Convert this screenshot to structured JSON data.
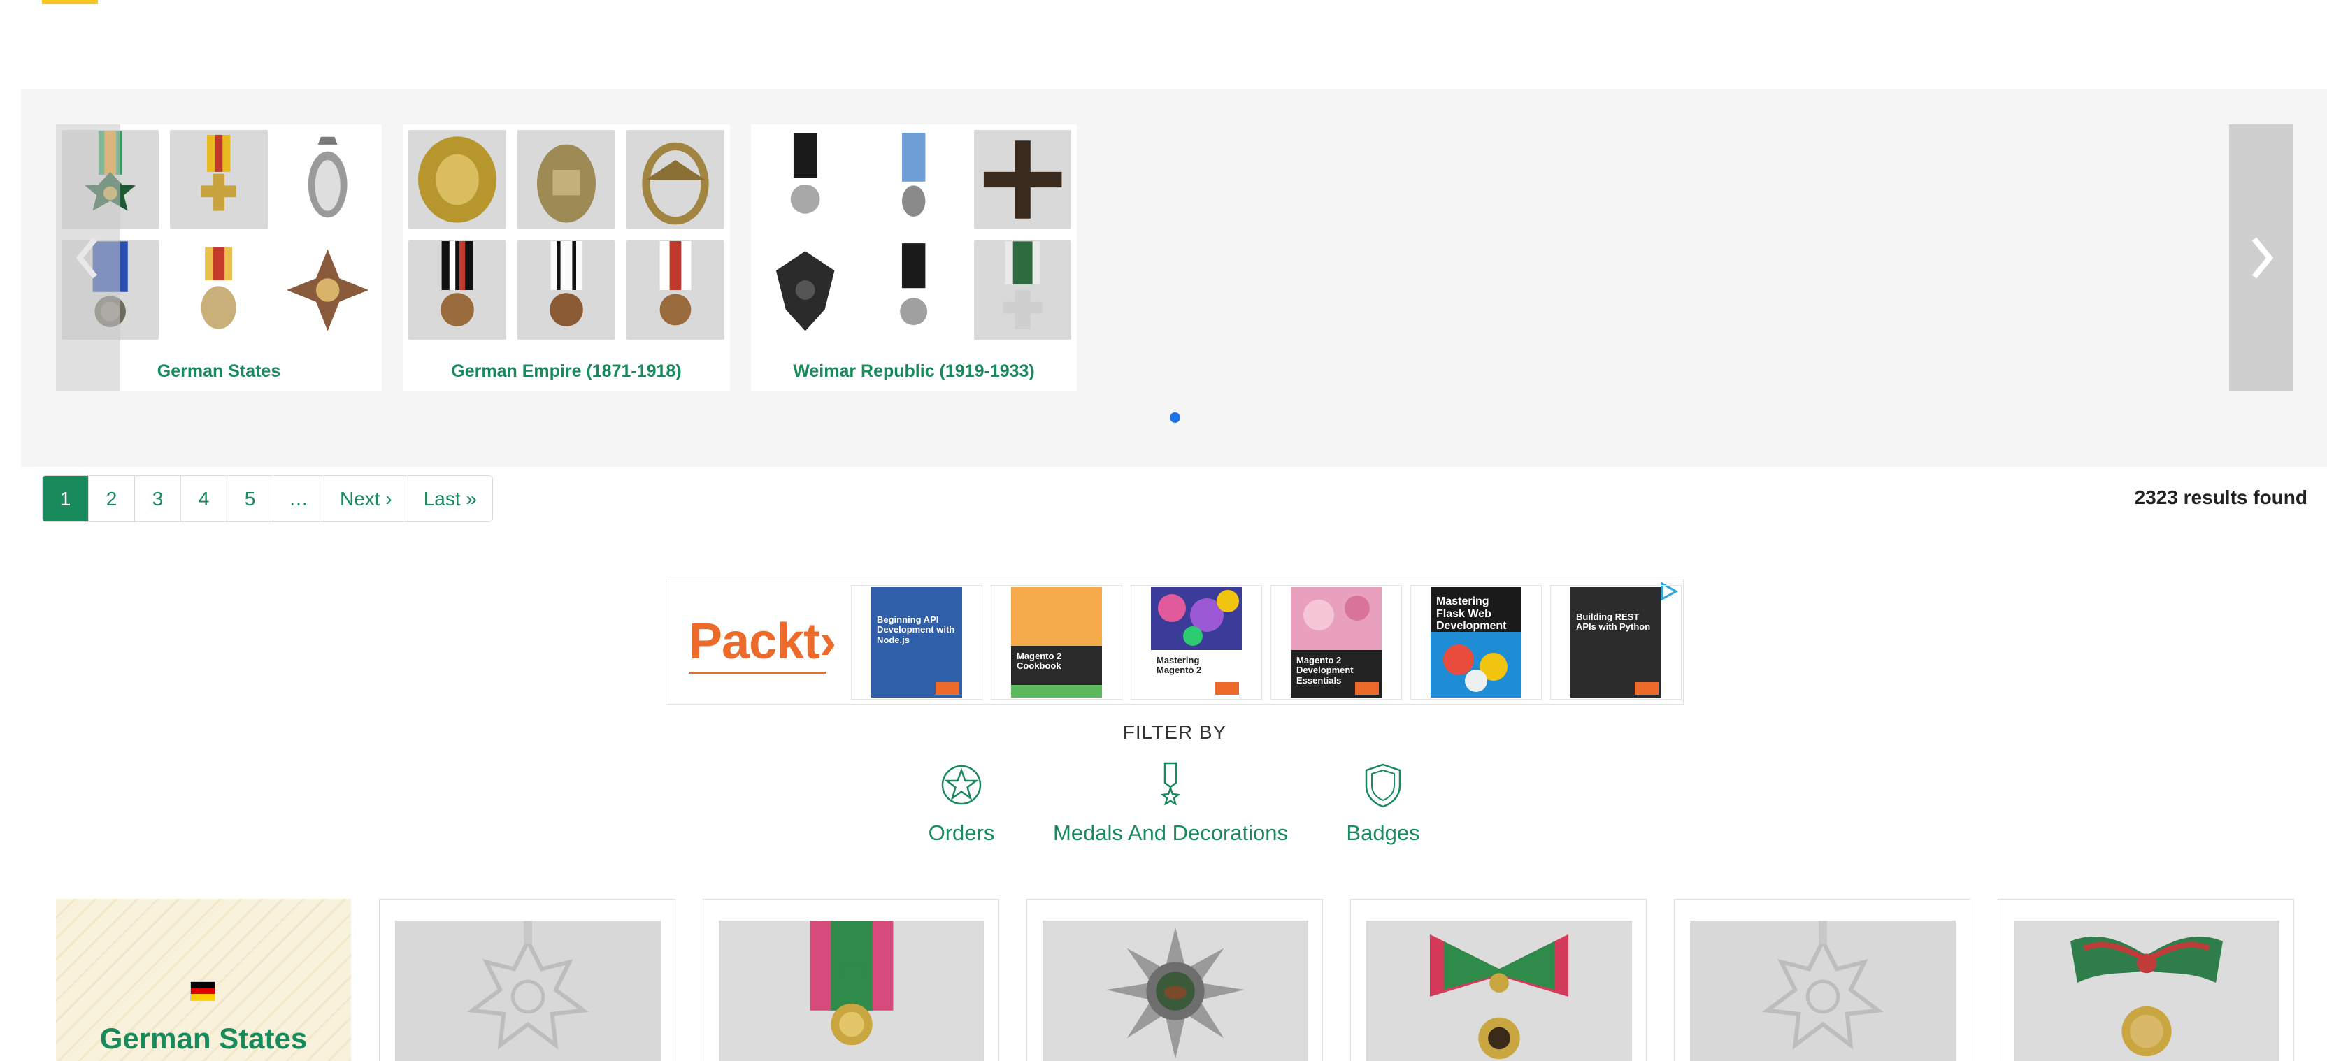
{
  "carousel": {
    "categories": [
      {
        "title": "German States"
      },
      {
        "title": "German Empire (1871-1918)"
      },
      {
        "title": "Weimar Republic (1919-1933)"
      }
    ]
  },
  "pagination": {
    "pages": [
      "1",
      "2",
      "3",
      "4",
      "5",
      "…",
      "Next ›",
      "Last »"
    ],
    "active": "1"
  },
  "results": "2323 results found",
  "ad": {
    "brand": "Packt›",
    "books": [
      {
        "title": "Beginning API Development with Node.js",
        "color": "#2f5fa8"
      },
      {
        "title": "Magento 2 Cookbook",
        "color": "#f4a94a"
      },
      {
        "title": "Mastering Magento 2",
        "color": "#3b3b9a"
      },
      {
        "title": "Magento 2 Development Essentials",
        "color": "#c76a8c"
      },
      {
        "title": "Mastering Flask Web Development",
        "color": "#1f8dd6"
      },
      {
        "title": "Building REST APIs with Python",
        "color": "#2c2c2c"
      }
    ]
  },
  "filter": {
    "title": "FILTER BY",
    "items": [
      {
        "label": "Orders",
        "icon": "star-medal-icon"
      },
      {
        "label": "Medals And Decorations",
        "icon": "ribbon-medal-icon"
      },
      {
        "label": "Badges",
        "icon": "shield-badge-icon"
      }
    ]
  },
  "state_card": {
    "name": "German States"
  },
  "colors": {
    "accent": "#188a5b",
    "brand": "#ec6a2a",
    "dot": "#1a73e8",
    "top_bar": "#f5c518"
  }
}
